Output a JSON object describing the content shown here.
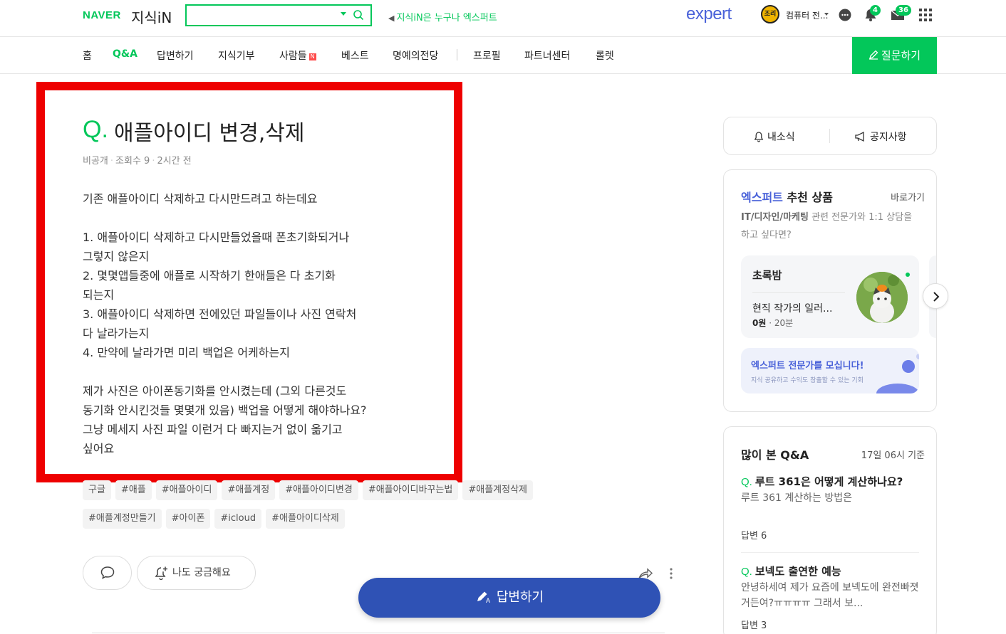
{
  "header": {
    "logo_naver": "NAVER",
    "logo_service": "지식iN",
    "search": {
      "value": "",
      "placeholder": ""
    },
    "notice": "지식iN은 누구나 엑스퍼트",
    "expert_logo": "expert",
    "user": {
      "avatar_text": "조리",
      "name": "컴퓨터 전..."
    },
    "badges": {
      "notifications": "4",
      "messages": "36"
    }
  },
  "nav": {
    "items": [
      "홈",
      "Q&A",
      "답변하기",
      "지식기부",
      "사람들",
      "베스트",
      "명예의전당",
      "프로필",
      "파트너센터",
      "롤렛"
    ],
    "active": "Q&A",
    "new_badge": "N",
    "ask_button": "질문하기"
  },
  "question": {
    "q_mark": "Q.",
    "title": "애플아이디 변경,삭제",
    "meta": {
      "visibility": "비공개",
      "views": "조회수 9",
      "time": "2시간 전"
    },
    "body_lines": [
      "기존 애플아이디 삭제하고 다시만드려고 하는데요",
      "",
      "1. 애플아이디 삭제하고 다시만들었을때 폰초기화되거나",
      "그렇지 않은지",
      "2. 몇몇앱들중에 애플로 시작하기 한애들은 다 초기화",
      "되는지",
      "3. 애플아이디 삭제하면 전에있던 파일들이나 사진 연락처",
      "다 날라가는지",
      "4. 만약에 날라가면 미리 백업은 어케하는지",
      "",
      "제가 사진은 아이폰동기화를 안시켰는데 (그외 다른것도",
      "동기화 안시킨것들 몇몇개 있음) 백업을 어떻게 해야하나요?",
      "그냥 메세지 사진 파일 이런거 다 빠지는거 없이 옮기고",
      "싶어요"
    ],
    "tags": [
      "구글",
      "#애플",
      "#애플아이디",
      "#애플계정",
      "#애플아이디변경",
      "#애플아이디바꾸는법",
      "#애플계정삭제",
      "#애플계정만들기",
      "#아이폰",
      "#icloud",
      "#애플아이디삭제"
    ],
    "curious_button": "나도 궁금해요",
    "answer_button": "답변하기"
  },
  "sidebar": {
    "mini_tabs": [
      "내소식",
      "공지사항"
    ],
    "expert": {
      "title_blue": "엑스퍼트",
      "title_rest": " 추천 상품",
      "link": "바로가기",
      "desc_bold": "IT/디자인/마케팅",
      "desc_rest": " 관련 전문가와 1:1 상담을 하고 싶다면?",
      "card": {
        "name": "초록밤",
        "title": "현직 작가의 일러...",
        "price": "0원",
        "duration": "20분"
      },
      "recruit_title": "엑스퍼트 전문가를 모십니다!",
      "recruit_sub": "지식 공유하고 수익도 창출할 수 있는 기회"
    },
    "popular": {
      "title": "많이 본 Q&A",
      "time": "17일 06시 기준",
      "items": [
        {
          "title": "루트 361은 어떻게 계산하나요?",
          "body": "루트 361 계산하는 방법은",
          "answers": "답변 6"
        },
        {
          "title": "보넥도 출연한 예능",
          "body": "안녕하세여 제가 요즘에 보넥도에 완전빠졋거든여?ㅠㅠㅠㅠ 그래서 보...",
          "answers": "답변 3"
        }
      ]
    }
  },
  "colors": {
    "brand_green": "#03c75a",
    "expert_blue": "#4a62d9",
    "answer_button": "#2f52b5",
    "highlight_red": "#ee0000"
  }
}
